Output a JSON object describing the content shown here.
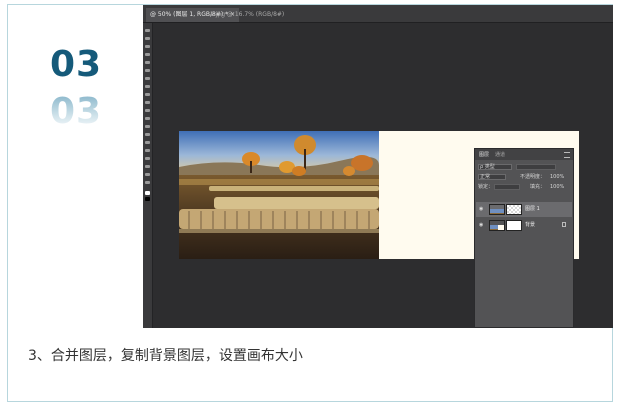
{
  "step": {
    "number": "03",
    "reflection": "03"
  },
  "caption": "3、合并图层，复制背景图层，设置画布大小",
  "photoshop": {
    "tabs": [
      {
        "label": "@ 50% (图层 1, RGB/8#) * ×"
      },
      {
        "label": "2.jpg @ 16.7% (RGB/8#)"
      }
    ]
  },
  "layers_panel": {
    "tabs": [
      "图层",
      "通道"
    ],
    "kind_filter": "ρ 类型",
    "blend_mode": "正常",
    "opacity_label": "不透明度：",
    "opacity_value": "100%",
    "lock_label": "锁定：",
    "fill_label": "填充：",
    "fill_value": "100%",
    "layers": [
      {
        "name": "图层 1",
        "selected": true
      },
      {
        "name": "背景",
        "selected": false
      }
    ]
  },
  "colors": {
    "accent": "#155a7a",
    "frame_border": "#b7d6dd",
    "ps_background": "#2d2d2f",
    "canvas_fill": "#fffbef"
  }
}
